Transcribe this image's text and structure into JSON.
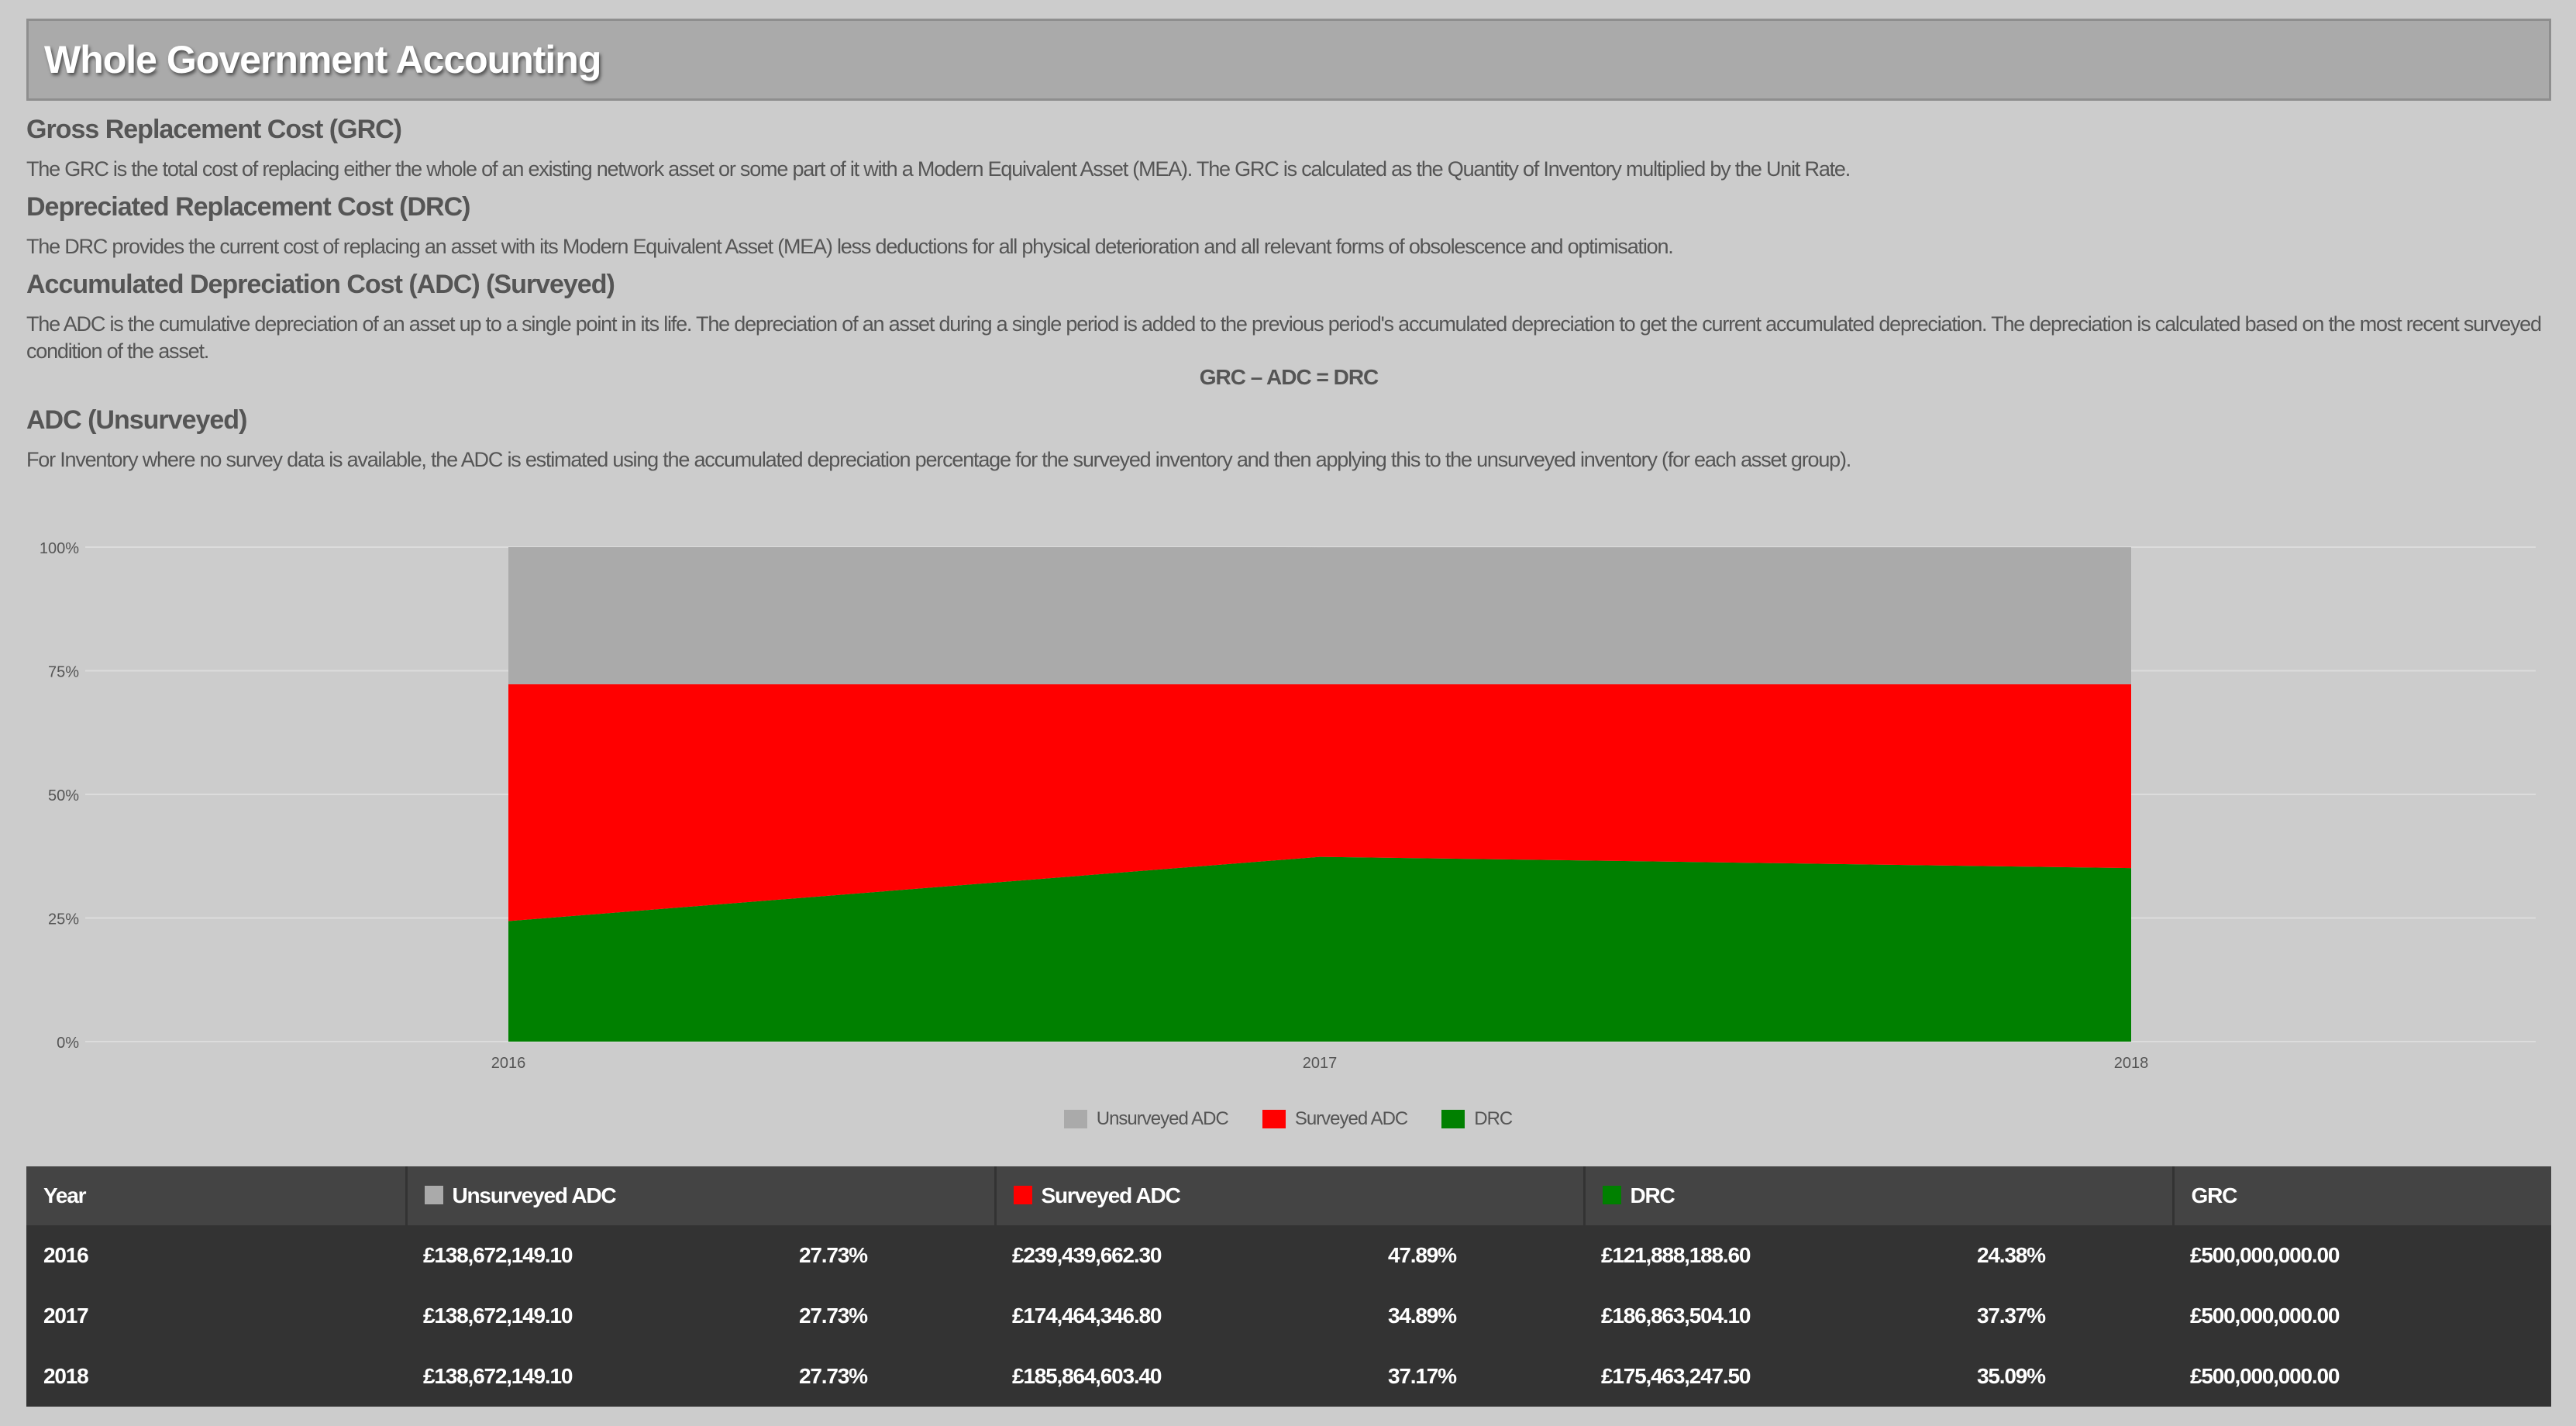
{
  "header": {
    "title": "Whole Government Accounting"
  },
  "sections": {
    "grc": {
      "title": "Gross Replacement Cost (GRC)",
      "text": "The GRC is the total cost of replacing either the whole of an existing network asset or some part of it with a Modern Equivalent Asset (MEA). The GRC is calculated as the Quantity of Inventory multiplied by the Unit Rate."
    },
    "drc": {
      "title": "Depreciated Replacement Cost (DRC)",
      "text": "The DRC provides the current cost of replacing an asset with its Modern Equivalent Asset (MEA) less deductions for all physical deterioration and all relevant forms of obsolescence and optimisation."
    },
    "adc_surveyed": {
      "title": "Accumulated Depreciation Cost (ADC) (Surveyed)",
      "text": "The ADC is the cumulative depreciation of an asset up to a single point in its life. The depreciation of an asset during a single period is added to the previous period's accumulated depreciation to get the current accumulated depreciation. The depreciation is calculated based on the most recent surveyed condition of the asset.",
      "formula": "GRC – ADC = DRC"
    },
    "adc_unsurveyed": {
      "title": "ADC (Unsurveyed)",
      "text": "For Inventory where no survey data is available, the ADC is estimated using the accumulated depreciation percentage for the surveyed inventory and then applying this to the unsurveyed inventory (for each asset group)."
    }
  },
  "chart_data": {
    "type": "area",
    "stacked": true,
    "normalized": true,
    "categories": [
      "2016",
      "2017",
      "2018"
    ],
    "series": [
      {
        "name": "DRC",
        "color": "#008000",
        "values": [
          24.38,
          37.37,
          35.09
        ]
      },
      {
        "name": "Surveyed ADC",
        "color": "#ff0000",
        "values": [
          47.89,
          34.89,
          37.17
        ]
      },
      {
        "name": "Unsurveyed ADC",
        "color": "#aaaaaa",
        "values": [
          27.73,
          27.73,
          27.73
        ]
      }
    ],
    "ylim": [
      0,
      100
    ],
    "yticks": [
      "0%",
      "25%",
      "50%",
      "75%",
      "100%"
    ],
    "grid": true,
    "legend": "bottom-center",
    "legend_order": [
      "Unsurveyed ADC",
      "Surveyed ADC",
      "DRC"
    ]
  },
  "table": {
    "headers": {
      "year": "Year",
      "unsurveyed": "Unsurveyed ADC",
      "surveyed": "Surveyed ADC",
      "drc": "DRC",
      "grc": "GRC"
    },
    "header_colors": {
      "unsurveyed": "#aaaaaa",
      "surveyed": "#ff0000",
      "drc": "#008000"
    },
    "rows": [
      {
        "year": "2016",
        "unsurveyed_amt": "£138,672,149.10",
        "unsurveyed_pct": "27.73%",
        "surveyed_amt": "£239,439,662.30",
        "surveyed_pct": "47.89%",
        "drc_amt": "£121,888,188.60",
        "drc_pct": "24.38%",
        "grc": "£500,000,000.00"
      },
      {
        "year": "2017",
        "unsurveyed_amt": "£138,672,149.10",
        "unsurveyed_pct": "27.73%",
        "surveyed_amt": "£174,464,346.80",
        "surveyed_pct": "34.89%",
        "drc_amt": "£186,863,504.10",
        "drc_pct": "37.37%",
        "grc": "£500,000,000.00"
      },
      {
        "year": "2018",
        "unsurveyed_amt": "£138,672,149.10",
        "unsurveyed_pct": "27.73%",
        "surveyed_amt": "£185,864,603.40",
        "surveyed_pct": "37.17%",
        "drc_amt": "£175,463,247.50",
        "drc_pct": "35.09%",
        "grc": "£500,000,000.00"
      }
    ]
  }
}
